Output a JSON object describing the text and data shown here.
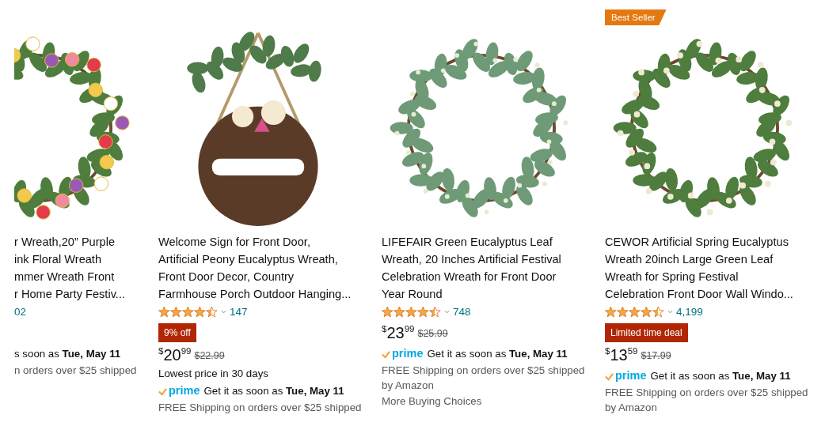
{
  "products": [
    {
      "kind": "flower-wreath",
      "title_lines": [
        "r Wreath,20” Purple",
        "ink Floral Wreath",
        "mmer Wreath Front",
        "r Home Party Festiv..."
      ],
      "rating_count": "02",
      "delivery": "s soon as **Tue, May 11**",
      "shipping": "n orders over $25 shipped"
    },
    {
      "kind": "welcome-sign",
      "title_lines": [
        "Welcome Sign for Front Door,",
        "Artificial Peony Eucalyptus Wreath,",
        "Front Door Decor, Country",
        "Farmhouse Porch Outdoor Hanging..."
      ],
      "stars": 4.5,
      "rating_count": "147",
      "deal_badge": "9% off",
      "price_symbol": "$",
      "price_whole": "20",
      "price_fraction": "99",
      "list_price": "$22.99",
      "price_note": "Lowest price in 30 days",
      "prime_label": "prime",
      "delivery": "Get it as soon as **Tue, May 11**",
      "shipping": "FREE Shipping on orders over $25 shipped"
    },
    {
      "kind": "green-wreath",
      "title_lines": [
        "LIFEFAIR Green Eucalyptus Leaf",
        "Wreath, 20 Inches Artificial Festival",
        "Celebration Wreath for Front Door",
        "Year Round"
      ],
      "stars": 4.5,
      "rating_count": "748",
      "price_symbol": "$",
      "price_whole": "23",
      "price_fraction": "99",
      "list_price": "$25.99",
      "prime_label": "prime",
      "delivery": "Get it as soon as **Tue, May 11**",
      "shipping": "FREE Shipping on orders over $25 shipped",
      "shipping_by": "by Amazon",
      "more_choices": "More Buying Choices"
    },
    {
      "badge": "Best Seller",
      "kind": "berry-wreath",
      "title_lines": [
        "CEWOR Artificial Spring Eucalyptus",
        "Wreath 20inch Large Green Leaf",
        "Wreath for Spring Festival",
        "Celebration Front Door Wall Windo..."
      ],
      "stars": 4.5,
      "rating_count": "4,199",
      "deal_badge": "Limited time deal",
      "price_symbol": "$",
      "price_whole": "13",
      "price_fraction": "59",
      "list_price": "$17.99",
      "prime_label": "prime",
      "delivery": "Get it as soon as **Tue, May 11**",
      "shipping": "FREE Shipping on orders over $25 shipped",
      "shipping_by": "by Amazon"
    }
  ]
}
